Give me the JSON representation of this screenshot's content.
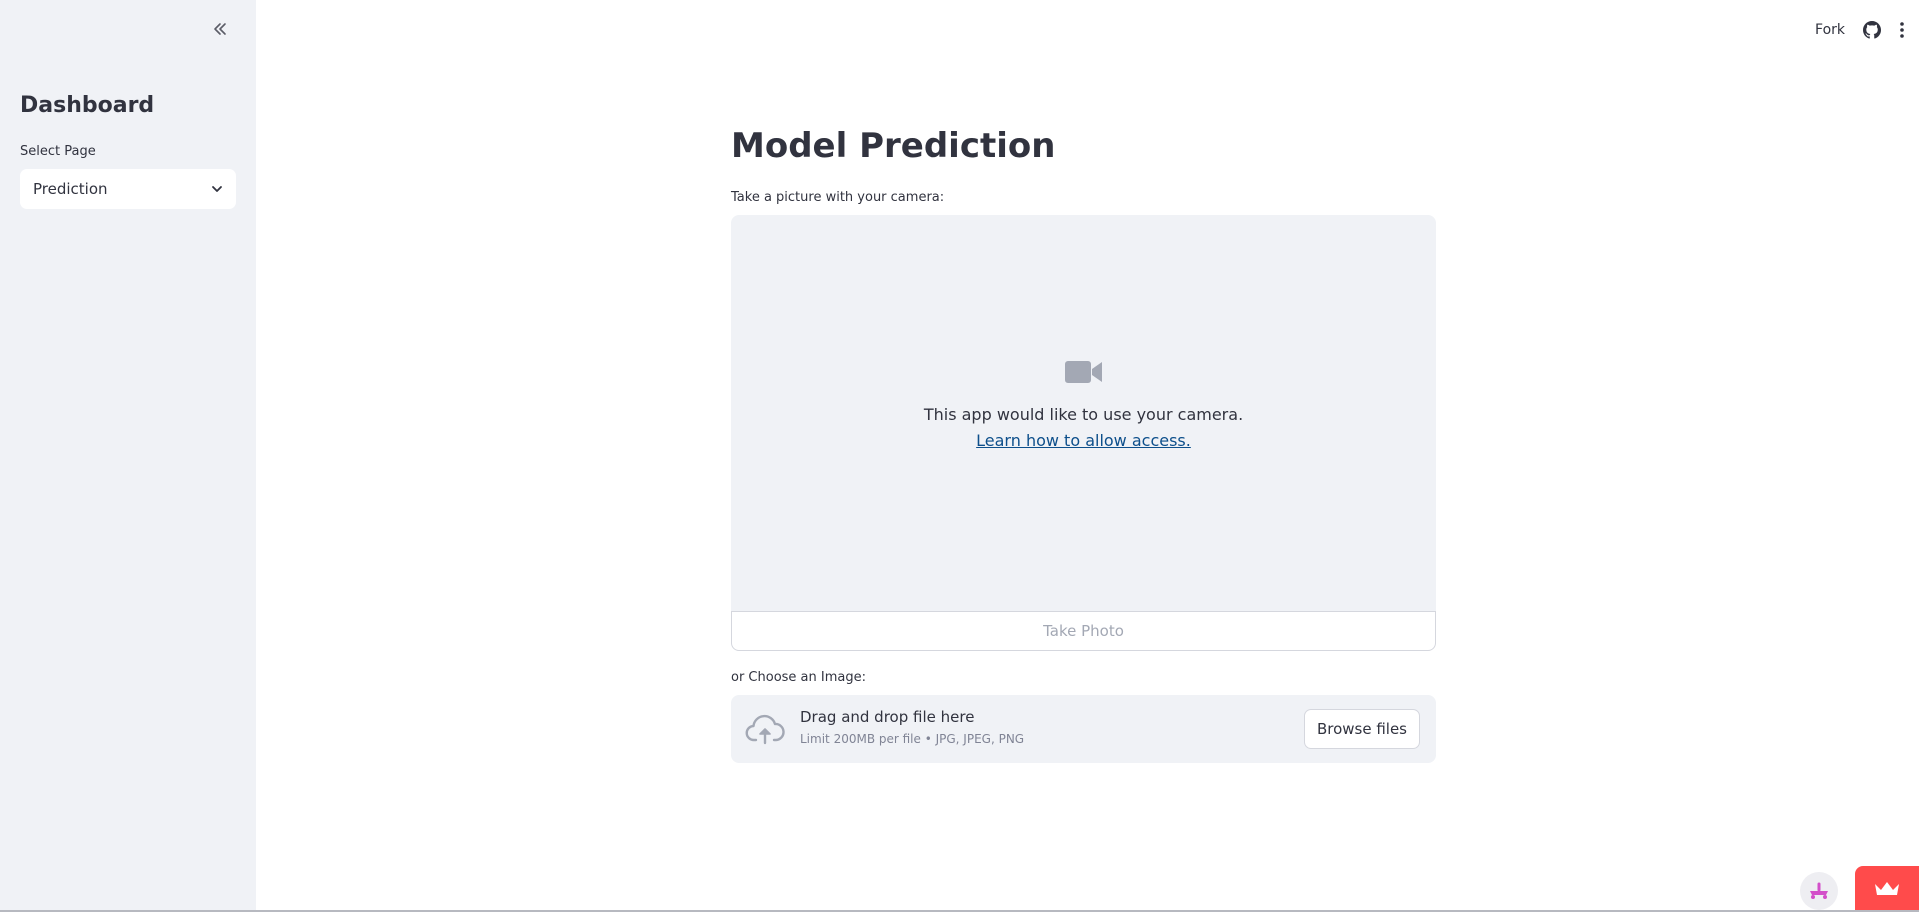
{
  "sidebar": {
    "collapse_icon": "double-chevron-left-icon",
    "title": "Dashboard",
    "select_label": "Select Page",
    "select_value": "Prediction",
    "select_icon": "chevron-down-icon"
  },
  "toolbar": {
    "fork_label": "Fork",
    "github_icon": "github-icon",
    "menu_icon": "vertical-dots-menu-icon"
  },
  "main": {
    "title": "Model Prediction",
    "camera": {
      "label": "Take a picture with your camera:",
      "icon": "video-camera-icon",
      "message": "This app would like to use your camera.",
      "link_text": "Learn how to allow access.",
      "button_label": "Take Photo"
    },
    "uploader": {
      "label": "or Choose an Image:",
      "icon": "cloud-upload-icon",
      "title": "Drag and drop file here",
      "subtitle": "Limit 200MB per file • JPG, JPEG, PNG",
      "button_label": "Browse files"
    }
  },
  "footer": {
    "status_icon": "streamlit-status-icon",
    "badge_icon": "crown-icon"
  },
  "colors": {
    "sidebar_bg": "#f0f2f6",
    "text": "#31333f",
    "link": "#0d4f8b",
    "accent": "#ff4b4b",
    "muted": "#808495"
  }
}
